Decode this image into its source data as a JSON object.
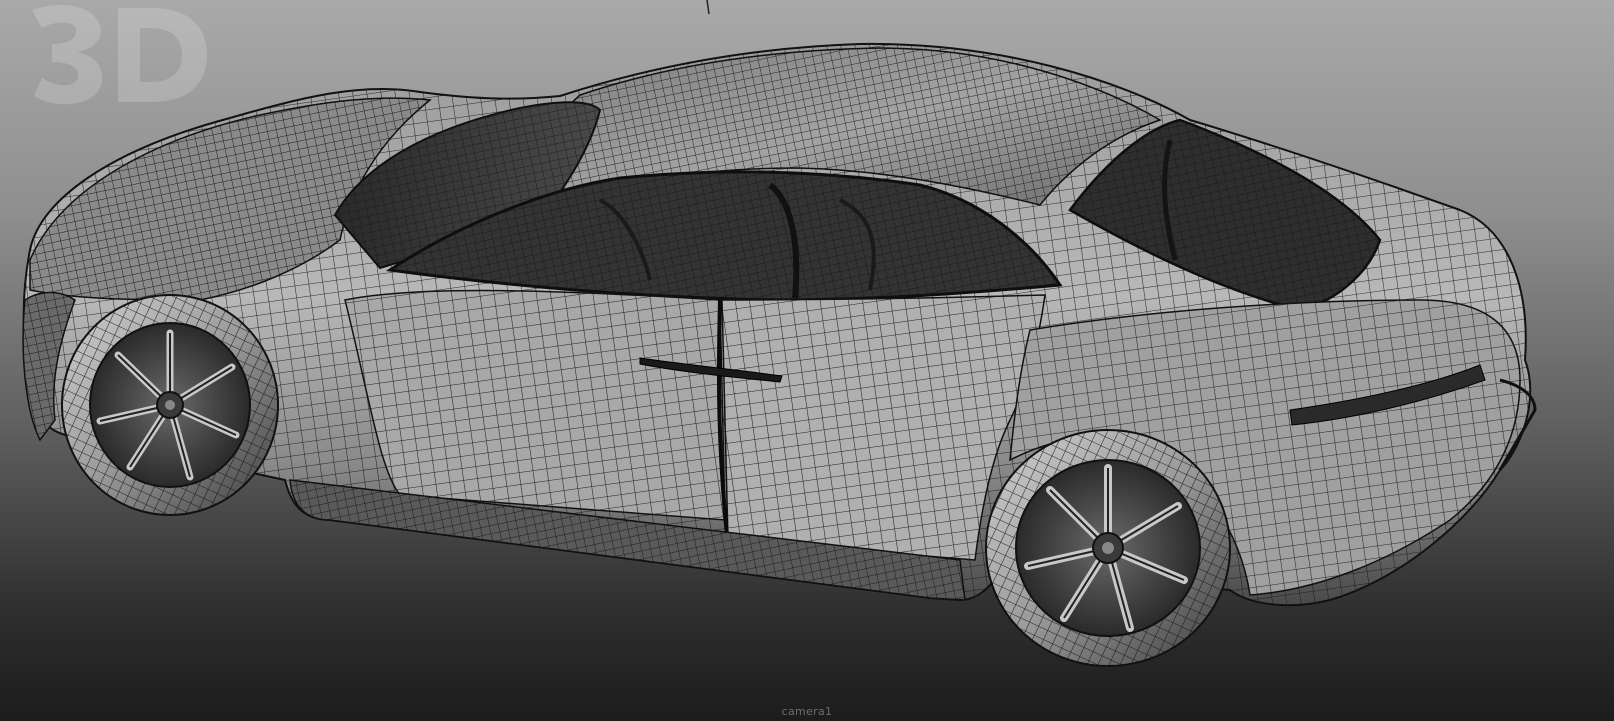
{
  "viewport": {
    "camera_name": "camera1",
    "background": {
      "top": "#a9a9a9",
      "bottom": "#1c1c1c"
    },
    "display_mode": "wireframe-on-shaded"
  },
  "scene": {
    "object": "sports-car-model",
    "wire_color": "#1a1a1a",
    "surface_color": "#8f8f8f"
  },
  "overlay": {
    "watermark_icon": "logo-watermark-icon"
  }
}
